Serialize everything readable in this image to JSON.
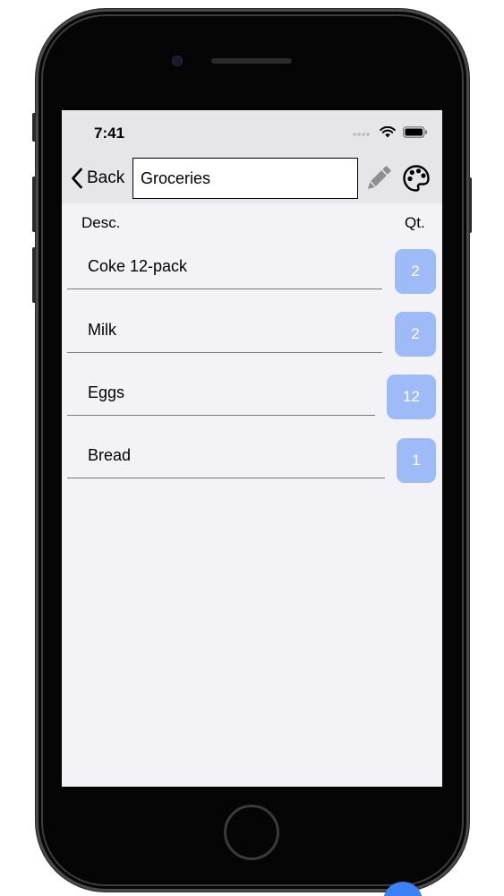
{
  "status_bar": {
    "time": "7:41"
  },
  "nav": {
    "back_label": "Back",
    "title_value": "Groceries",
    "edit_icon": "pencil-icon",
    "palette_icon": "palette-icon"
  },
  "columns": {
    "desc": "Desc.",
    "qty": "Qt."
  },
  "items": [
    {
      "desc": "Coke 12-pack",
      "qty": "2"
    },
    {
      "desc": "Milk",
      "qty": "2"
    },
    {
      "desc": "Eggs",
      "qty": "12"
    },
    {
      "desc": "Bread",
      "qty": "1"
    }
  ],
  "colors": {
    "qty_button": "#9fbbf7",
    "bar_background": "#e5e5ea",
    "screen_background": "#f2f2f7"
  }
}
